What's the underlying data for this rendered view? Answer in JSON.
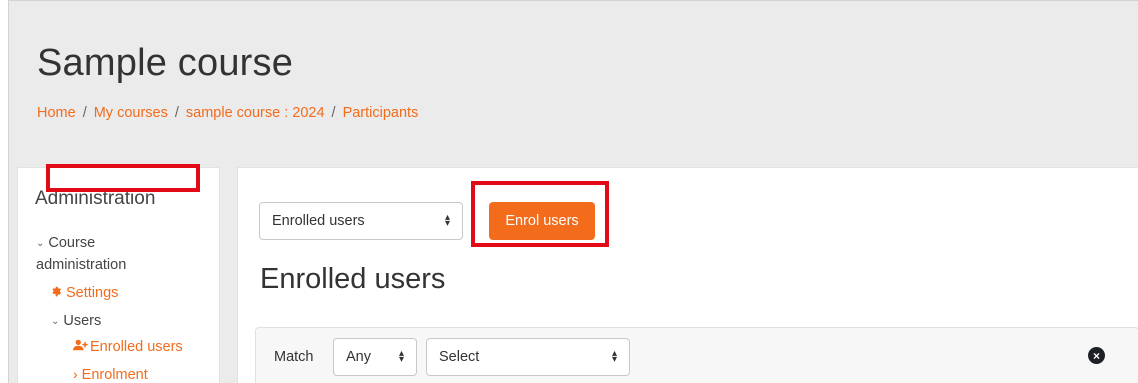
{
  "header": {
    "title": "Sample course",
    "breadcrumb": [
      {
        "label": "Home"
      },
      {
        "label": "My courses"
      },
      {
        "label": "sample course : 2024"
      },
      {
        "label": "Participants"
      }
    ],
    "separator": "/"
  },
  "sidebar": {
    "title": "Administration",
    "items": [
      {
        "label": "Course",
        "chevron": "⌄"
      },
      {
        "label": "administration"
      },
      {
        "label": "Settings",
        "icon": "gear-icon"
      },
      {
        "label": "Users",
        "chevron": "⌄"
      },
      {
        "label": "Enrolled users",
        "icon": "user-plus-icon"
      },
      {
        "label": "Enrolment",
        "chevron": "›"
      }
    ]
  },
  "main": {
    "enrolment_select": {
      "value": "Enrolled users"
    },
    "enrol_button": {
      "label": "Enrol users"
    },
    "heading": "Enrolled users",
    "filter": {
      "match_label": "Match",
      "match_select": {
        "value": "Any"
      },
      "type_select": {
        "value": "Select"
      }
    }
  },
  "colors": {
    "accent": "#f26c1c",
    "highlight": "#e20a17",
    "page_background": "#ebebeb"
  }
}
